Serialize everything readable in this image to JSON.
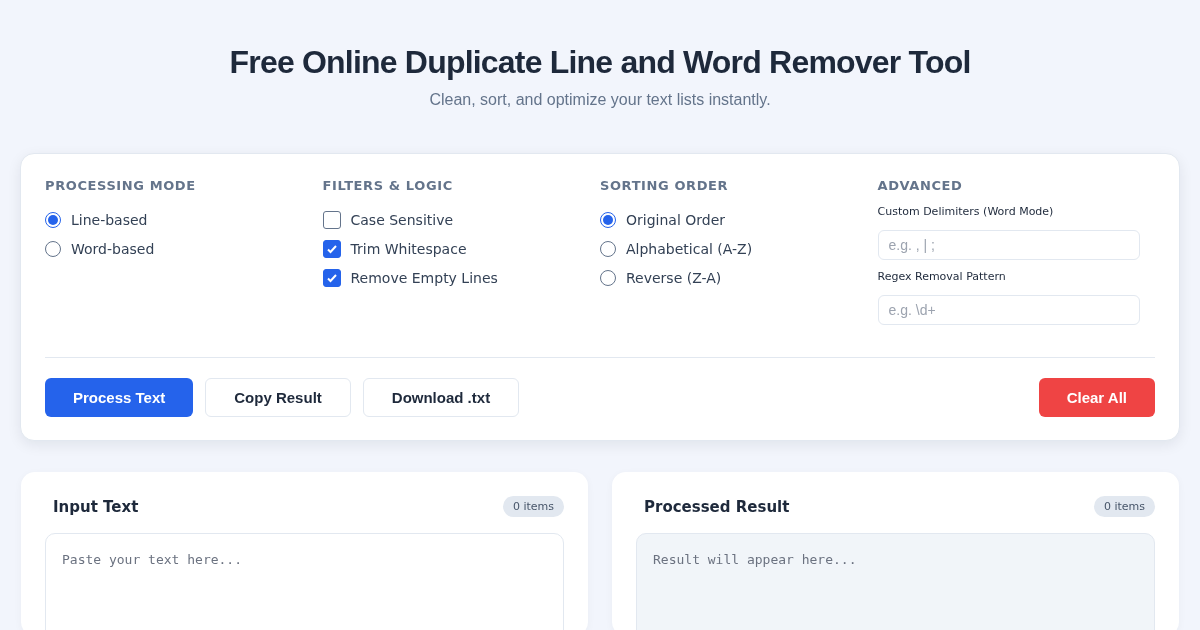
{
  "header": {
    "title": "Free Online Duplicate Line and Word Remover Tool",
    "subtitle": "Clean, sort, and optimize your text lists instantly."
  },
  "settings": {
    "groups": [
      {
        "kind": "radio",
        "title": "PROCESSING MODE",
        "options": [
          {
            "label": "Line-based",
            "selected": true
          },
          {
            "label": "Word-based",
            "selected": false
          }
        ]
      },
      {
        "kind": "checkbox",
        "title": "FILTERS & LOGIC",
        "options": [
          {
            "label": "Case Sensitive",
            "checked": false
          },
          {
            "label": "Trim Whitespace",
            "checked": true
          },
          {
            "label": "Remove Empty Lines",
            "checked": true
          }
        ]
      },
      {
        "kind": "radio",
        "title": "SORTING ORDER",
        "options": [
          {
            "label": "Original Order",
            "selected": true
          },
          {
            "label": "Alphabetical (A-Z)",
            "selected": false
          },
          {
            "label": "Reverse (Z-A)",
            "selected": false
          }
        ]
      },
      {
        "kind": "fields",
        "title": "ADVANCED",
        "fields": [
          {
            "label": "Custom Delimiters (Word Mode)",
            "placeholder": "e.g. , | ;"
          },
          {
            "label": "Regex Removal Pattern",
            "placeholder": "e.g. \\d+"
          }
        ]
      }
    ],
    "buttons": [
      {
        "label": "Process Text",
        "kind": "primary"
      },
      {
        "label": "Copy Result",
        "kind": "outline"
      },
      {
        "label": "Download .txt",
        "kind": "outline"
      },
      {
        "label": "Clear All",
        "kind": "danger"
      }
    ]
  },
  "panels": [
    {
      "title": "Input Text",
      "count": "0 items",
      "placeholder": "Paste your text here...",
      "readonly": false
    },
    {
      "title": "Processed Result",
      "count": "0 items",
      "placeholder": "Result will appear here...",
      "readonly": true
    }
  ]
}
